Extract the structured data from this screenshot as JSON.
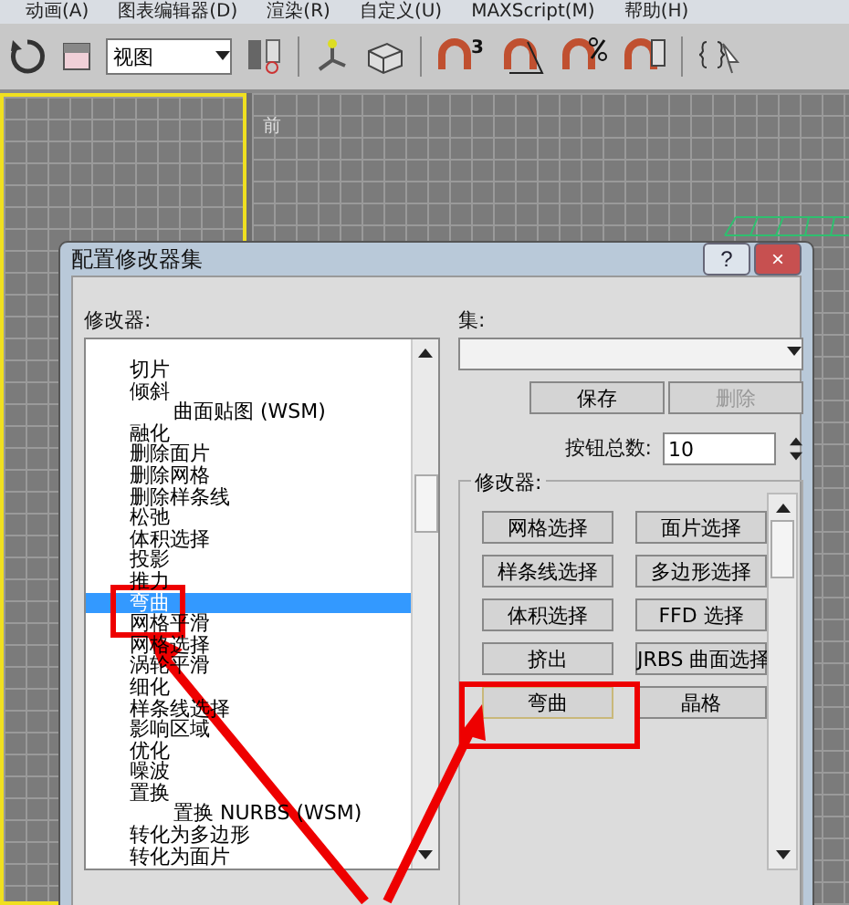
{
  "menu_bar": [
    "动画(A)",
    "图表编辑器(D)",
    "渲染(R)",
    "自定义(U)",
    "MAXScript(M)",
    "帮助(H)"
  ],
  "toolbar": {
    "view_dropdown": "视图",
    "snap_label": "3"
  },
  "viewport": {
    "label": "前"
  },
  "dialog": {
    "title": "配置修改器集",
    "help": "?",
    "close": "×",
    "modifiers_label": "修改器:",
    "modifiers": [
      {
        "label": "切片",
        "selected": false
      },
      {
        "label": "倾斜",
        "selected": false,
        "children": [
          {
            "label": "曲面贴图 (WSM)",
            "selected": false
          }
        ]
      },
      {
        "label": "融化",
        "selected": false
      },
      {
        "label": "删除面片",
        "selected": false
      },
      {
        "label": "删除网格",
        "selected": false
      },
      {
        "label": "删除样条线",
        "selected": false
      },
      {
        "label": "松弛",
        "selected": false
      },
      {
        "label": "体积选择",
        "selected": false
      },
      {
        "label": "投影",
        "selected": false
      },
      {
        "label": "推力",
        "selected": false
      },
      {
        "label": "弯曲",
        "selected": true
      },
      {
        "label": "网格平滑",
        "selected": false
      },
      {
        "label": "网格选择",
        "selected": false
      },
      {
        "label": "涡轮平滑",
        "selected": false
      },
      {
        "label": "细化",
        "selected": false
      },
      {
        "label": "样条线选择",
        "selected": false
      },
      {
        "label": "影响区域",
        "selected": false
      },
      {
        "label": "优化",
        "selected": false
      },
      {
        "label": "噪波",
        "selected": false
      },
      {
        "label": "置换",
        "selected": false,
        "children": [
          {
            "label": "置换 NURBS (WSM)",
            "selected": false
          }
        ]
      },
      {
        "label": "转化为多边形",
        "selected": false
      },
      {
        "label": "转化为面片",
        "selected": false
      }
    ],
    "sets_label": "集:",
    "save": {
      "label": "保存",
      "disabled": false
    },
    "delete": {
      "label": "删除",
      "disabled": true
    },
    "count_label": "按钮总数:",
    "count_value": "10",
    "group_label": "修改器:",
    "buttons": [
      {
        "label": "网格选择",
        "highlighted": false
      },
      {
        "label": "面片选择",
        "highlighted": false
      },
      {
        "label": "样条线选择",
        "highlighted": false
      },
      {
        "label": "多边形选择",
        "highlighted": false
      },
      {
        "label": "体积选择",
        "highlighted": false
      },
      {
        "label": "FFD 选择",
        "highlighted": false
      },
      {
        "label": "挤出",
        "highlighted": false
      },
      {
        "label": "JRBS 曲面选择",
        "highlighted": false
      },
      {
        "label": "弯曲",
        "highlighted": true
      },
      {
        "label": "晶格",
        "highlighted": false
      }
    ]
  }
}
